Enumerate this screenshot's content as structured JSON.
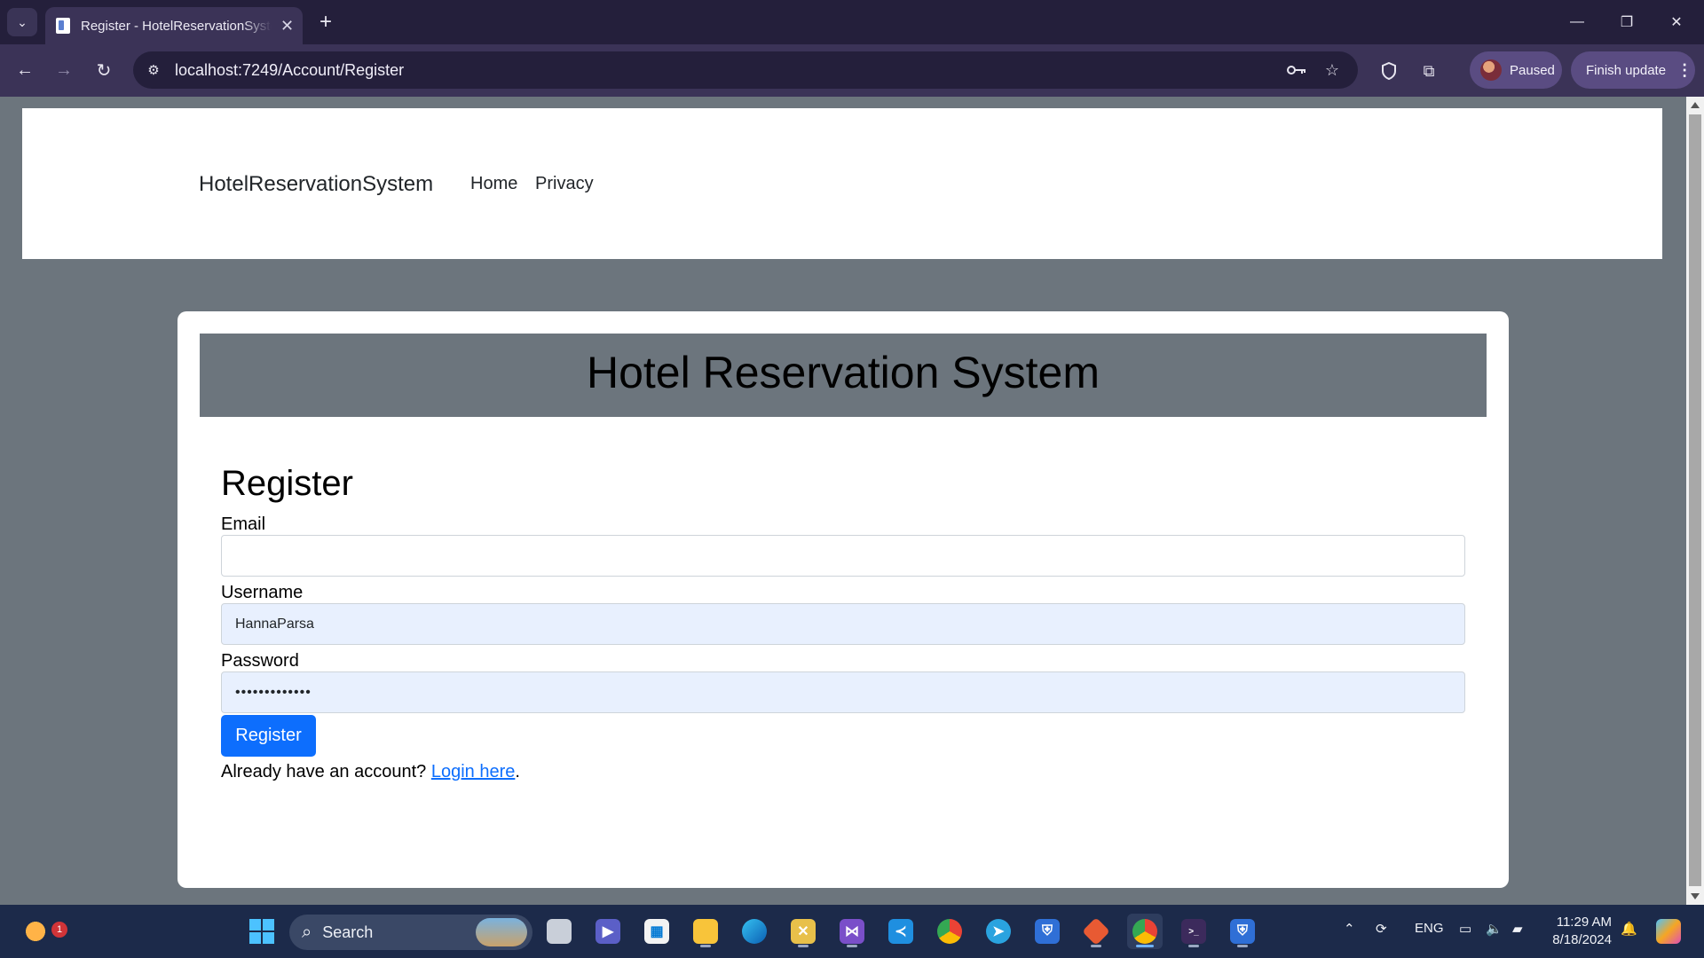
{
  "browser": {
    "tab_title": "Register - HotelReservationSystem",
    "tab_close": "✕",
    "new_tab": "+",
    "url": "localhost:7249/Account/Register",
    "profile_label": "Paused",
    "update_label": "Finish update",
    "window_controls": {
      "minimize": "—",
      "restore": "❐",
      "close": "✕"
    }
  },
  "site": {
    "brand": "HotelReservationSystem",
    "nav": [
      "Home",
      "Privacy"
    ]
  },
  "card": {
    "hero_title": "Hotel Reservation System"
  },
  "form": {
    "heading": "Register",
    "fields": [
      {
        "label": "Email",
        "value": "",
        "type": "email",
        "autofilled": false
      },
      {
        "label": "Username",
        "value": "HannaParsa",
        "type": "text",
        "autofilled": true
      },
      {
        "label": "Password",
        "value": "•••••••••••••",
        "type": "password",
        "autofilled": true
      }
    ],
    "submit_label": "Register",
    "login_prompt": "Already have an account?",
    "login_link": "Login here",
    "login_suffix": "."
  },
  "taskbar": {
    "search_label": "Search",
    "notification_count": "1",
    "language": "ENG",
    "time": "11:29 AM",
    "date": "8/18/2024",
    "apps": [
      "start-icon",
      "task-view-icon",
      "teams-icon",
      "store-icon",
      "file-explorer-icon",
      "edge-icon",
      "sql-tool-icon",
      "visual-studio-icon",
      "vscode-icon",
      "chrome-icon",
      "telegram-icon",
      "shield-app-icon",
      "git-icon",
      "chrome-active-icon",
      "terminal-icon",
      "shield-app-2-icon"
    ]
  },
  "colors": {
    "page_bg": "#6c757d",
    "primary_button": "#0d6efd",
    "autofill_bg": "#e8f0fe",
    "browser_chrome": "#3b3357",
    "taskbar": "#1c2a4a"
  }
}
